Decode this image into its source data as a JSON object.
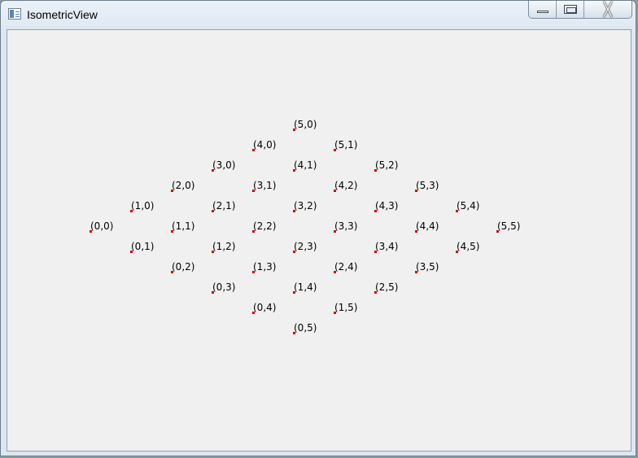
{
  "window": {
    "title": "IsometricView",
    "icon": "app-window-icon",
    "buttons": {
      "minimize": "minimize-icon",
      "maximize": "maximize-icon",
      "close": "close-icon",
      "close_glyph": "╳"
    }
  },
  "grid": {
    "size": 6,
    "point_color": "#d00000",
    "points": [
      {
        "label": "(0,0)",
        "i": 0,
        "j": 0
      },
      {
        "label": "(0,1)",
        "i": 0,
        "j": 1
      },
      {
        "label": "(0,2)",
        "i": 0,
        "j": 2
      },
      {
        "label": "(0,3)",
        "i": 0,
        "j": 3
      },
      {
        "label": "(0,4)",
        "i": 0,
        "j": 4
      },
      {
        "label": "(0,5)",
        "i": 0,
        "j": 5
      },
      {
        "label": "(1,0)",
        "i": 1,
        "j": 0
      },
      {
        "label": "(1,1)",
        "i": 1,
        "j": 1
      },
      {
        "label": "(1,2)",
        "i": 1,
        "j": 2
      },
      {
        "label": "(1,3)",
        "i": 1,
        "j": 3
      },
      {
        "label": "(1,4)",
        "i": 1,
        "j": 4
      },
      {
        "label": "(1,5)",
        "i": 1,
        "j": 5
      },
      {
        "label": "(2,0)",
        "i": 2,
        "j": 0
      },
      {
        "label": "(2,1)",
        "i": 2,
        "j": 1
      },
      {
        "label": "(2,2)",
        "i": 2,
        "j": 2
      },
      {
        "label": "(2,3)",
        "i": 2,
        "j": 3
      },
      {
        "label": "(2,4)",
        "i": 2,
        "j": 4
      },
      {
        "label": "(2,5)",
        "i": 2,
        "j": 5
      },
      {
        "label": "(3,0)",
        "i": 3,
        "j": 0
      },
      {
        "label": "(3,1)",
        "i": 3,
        "j": 1
      },
      {
        "label": "(3,2)",
        "i": 3,
        "j": 2
      },
      {
        "label": "(3,3)",
        "i": 3,
        "j": 3
      },
      {
        "label": "(3,4)",
        "i": 3,
        "j": 4
      },
      {
        "label": "(3,5)",
        "i": 3,
        "j": 5
      },
      {
        "label": "(4,0)",
        "i": 4,
        "j": 0
      },
      {
        "label": "(4,1)",
        "i": 4,
        "j": 1
      },
      {
        "label": "(4,2)",
        "i": 4,
        "j": 2
      },
      {
        "label": "(4,3)",
        "i": 4,
        "j": 3
      },
      {
        "label": "(4,4)",
        "i": 4,
        "j": 4
      },
      {
        "label": "(4,5)",
        "i": 4,
        "j": 5
      },
      {
        "label": "(5,0)",
        "i": 5,
        "j": 0
      },
      {
        "label": "(5,1)",
        "i": 5,
        "j": 1
      },
      {
        "label": "(5,2)",
        "i": 5,
        "j": 2
      },
      {
        "label": "(5,3)",
        "i": 5,
        "j": 3
      },
      {
        "label": "(5,4)",
        "i": 5,
        "j": 4
      },
      {
        "label": "(5,5)",
        "i": 5,
        "j": 5
      }
    ]
  }
}
